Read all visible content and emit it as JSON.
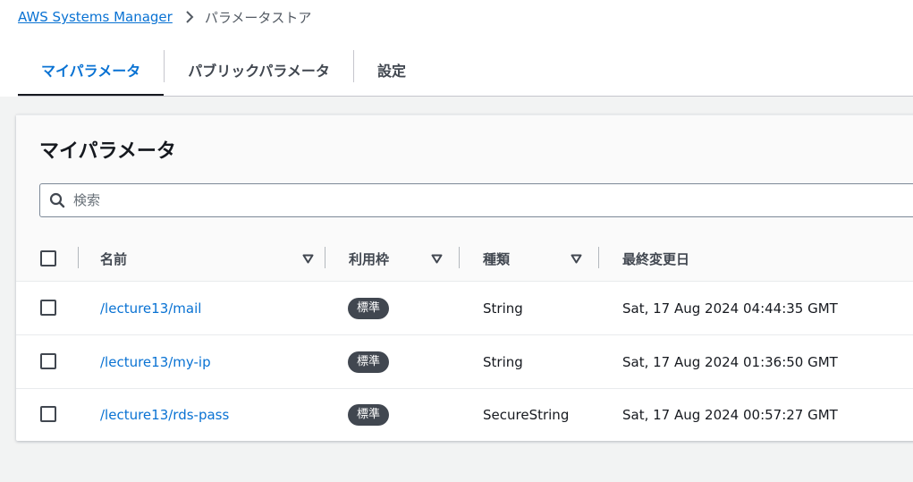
{
  "breadcrumb": {
    "service": "AWS Systems Manager",
    "separator_icon": "chevron-right-icon",
    "current": "パラメータストア"
  },
  "tabs": [
    {
      "label": "マイパラメータ",
      "active": true
    },
    {
      "label": "パブリックパラメータ",
      "active": false
    },
    {
      "label": "設定",
      "active": false
    }
  ],
  "panel": {
    "title": "マイパラメータ",
    "search_placeholder": "検索",
    "search_icon": "search-icon"
  },
  "table": {
    "columns": [
      {
        "label": "名前",
        "sortable": true
      },
      {
        "label": "利用枠",
        "sortable": true
      },
      {
        "label": "種類",
        "sortable": true
      },
      {
        "label": "最終変更日",
        "sortable": false
      }
    ],
    "rows": [
      {
        "name": "/lecture13/mail",
        "tier": "標準",
        "type": "String",
        "modified": "Sat, 17 Aug 2024 04:44:35 GMT"
      },
      {
        "name": "/lecture13/my-ip",
        "tier": "標準",
        "type": "String",
        "modified": "Sat, 17 Aug 2024 01:36:50 GMT"
      },
      {
        "name": "/lecture13/rds-pass",
        "tier": "標準",
        "type": "SecureString",
        "modified": "Sat, 17 Aug 2024 00:57:27 GMT"
      }
    ]
  },
  "colors": {
    "link": "#0972d3",
    "badge_bg": "#414750",
    "page_bg": "#f2f3f3"
  }
}
